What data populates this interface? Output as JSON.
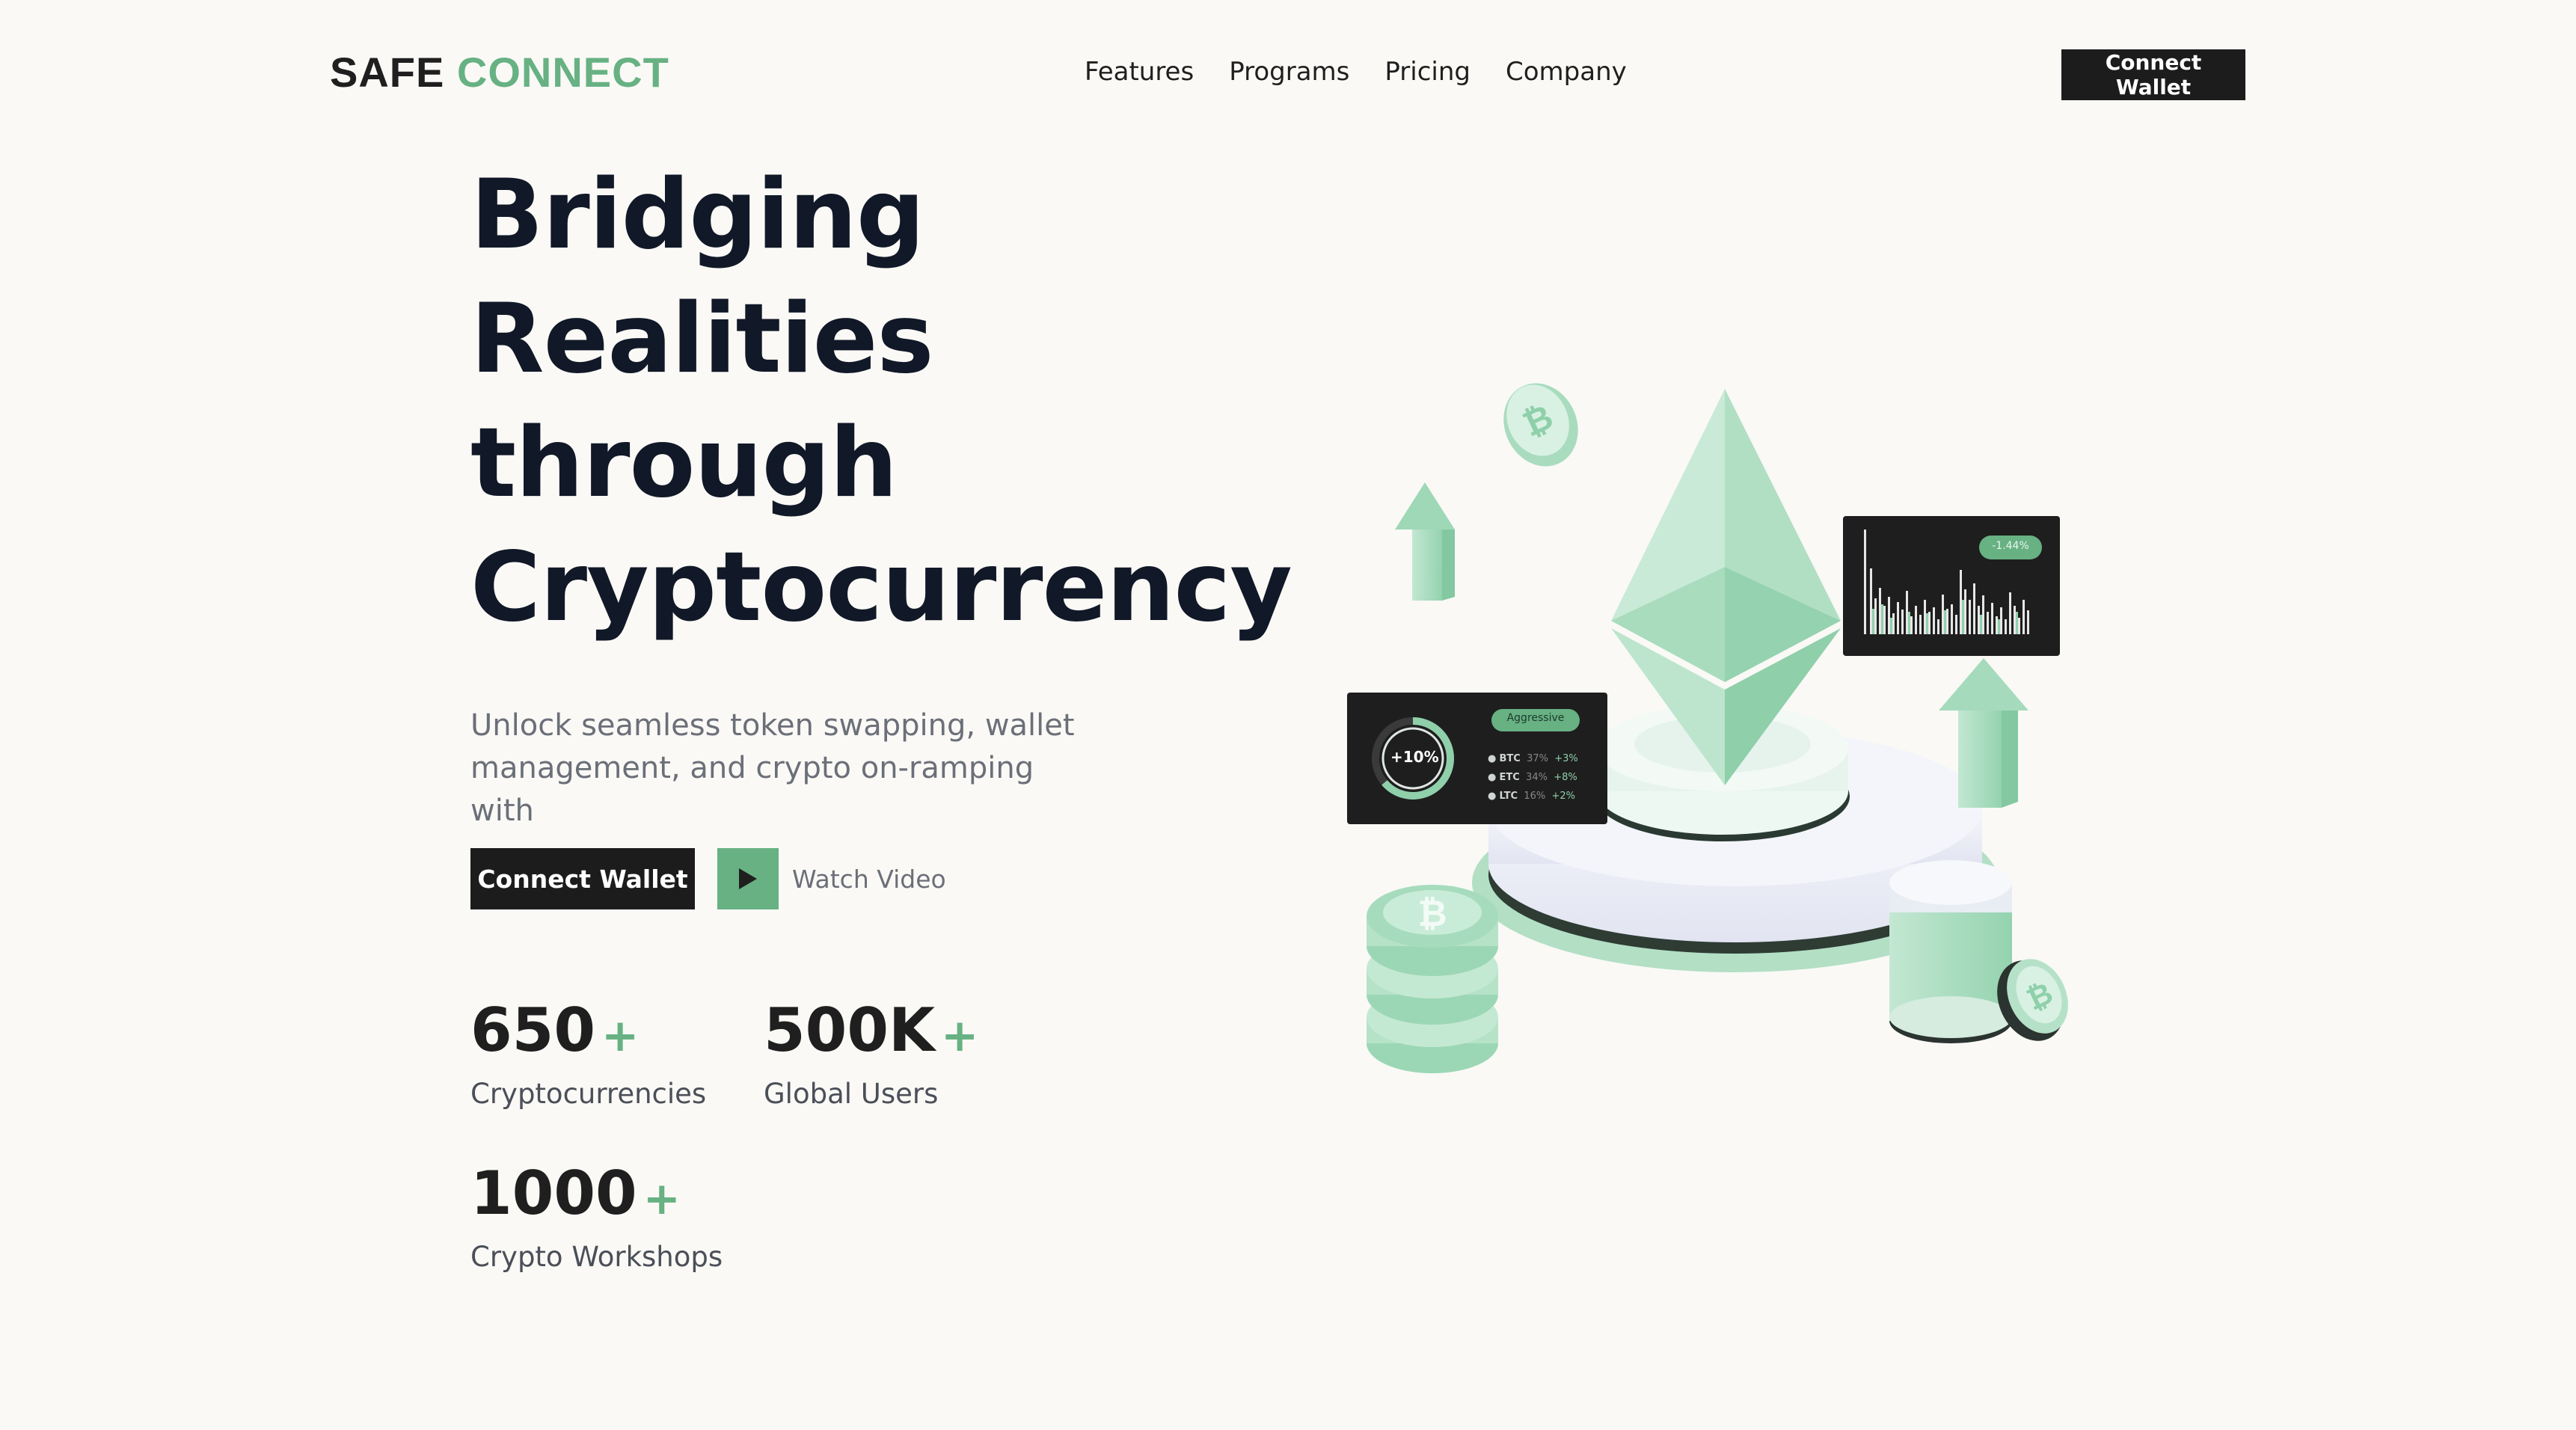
{
  "brand": {
    "part1": "SAFE",
    "part2": "CONNECT"
  },
  "nav": {
    "links": [
      "Features",
      "Programs",
      "Pricing",
      "Company"
    ],
    "cta": "Connect Wallet"
  },
  "hero": {
    "title_lines": [
      "Bridging",
      "Realities",
      "through",
      "Cryptocurrency"
    ],
    "subtitle": "Unlock seamless token swapping, wallet management, and crypto on-ramping with",
    "primary_cta": "Connect Wallet",
    "video_cta": "Watch Video"
  },
  "stats": [
    {
      "value": "650",
      "plus": "+",
      "label": "Cryptocurrencies"
    },
    {
      "value": "500K",
      "plus": "+",
      "label": "Global Users"
    },
    {
      "value": "1000",
      "plus": "+",
      "label": "Crypto Workshops"
    }
  ],
  "illustration": {
    "left_panel": {
      "gauge_value": "+10%",
      "strategy_badge": "Aggressive",
      "rows": [
        {
          "coin": "BTC",
          "share": "37%",
          "change": "+3%"
        },
        {
          "coin": "ETC",
          "share": "34%",
          "change": "+8%"
        },
        {
          "coin": "LTC",
          "share": "16%",
          "change": "+2%"
        }
      ]
    },
    "right_panel": {
      "change_badge": "-1.44%"
    }
  },
  "colors": {
    "accent": "#67b183",
    "dark": "#1c1c1c",
    "background": "#faf9f6"
  }
}
